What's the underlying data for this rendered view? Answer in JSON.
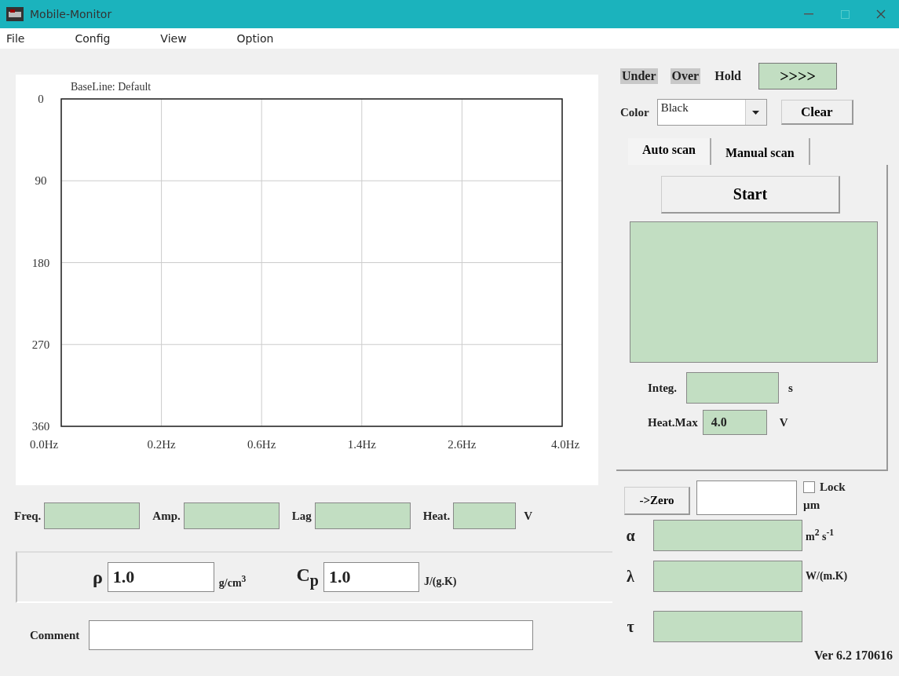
{
  "window": {
    "title": "Mobile-Monitor"
  },
  "menu": [
    "File",
    "Config",
    "View",
    "Option"
  ],
  "chart": {
    "chart_data": {
      "type": "line",
      "title": "BaseLine: Default",
      "categories": [
        "0.0Hz",
        "0.2Hz",
        "0.6Hz",
        "1.4Hz",
        "2.6Hz",
        "4.0Hz"
      ],
      "ylim": [
        360,
        0
      ],
      "grid": true,
      "yticks": [
        0,
        90,
        180,
        270,
        360
      ]
    }
  },
  "readings": [
    {
      "label": "Freq."
    },
    {
      "label": "Amp."
    },
    {
      "label": "Lag"
    },
    {
      "label": "Heat.",
      "unit": "V"
    }
  ],
  "material": {
    "rho": {
      "symbol": "ρ",
      "value": "1.0",
      "unit": "g/cm$^{3}$"
    },
    "cp": {
      "symbol": "C$_{p}$",
      "value": "1.0",
      "unit": "J/(g.K)"
    }
  },
  "comment": {
    "label": "Comment"
  },
  "indicators": [
    {
      "label": "Under",
      "on": true
    },
    {
      "label": "Over",
      "on": true
    },
    {
      "label": "Hold",
      "on": false
    }
  ],
  "arrow_button": ">>>>",
  "color": {
    "label": "Color",
    "value": "Black"
  },
  "clear_button": "Clear",
  "tabs": [
    {
      "label": "Auto scan",
      "selected": true
    },
    {
      "label": "Manual scan",
      "selected": false
    }
  ],
  "start_button": "Start",
  "integ": {
    "label": "Integ.",
    "unit": "s"
  },
  "heat_max": {
    "label": "Heat.Max",
    "value": "4.0",
    "unit": "V"
  },
  "zero_button": "->Zero",
  "lock": {
    "label": "Lock",
    "checked": false,
    "unit": "µm"
  },
  "results": [
    {
      "symbol": "α",
      "unit": "m$^{2}$ s$^{-1}$"
    },
    {
      "symbol": "λ",
      "unit": "W/(m.K)"
    },
    {
      "symbol": "τ"
    }
  ],
  "version": "Ver 6.2  170616"
}
